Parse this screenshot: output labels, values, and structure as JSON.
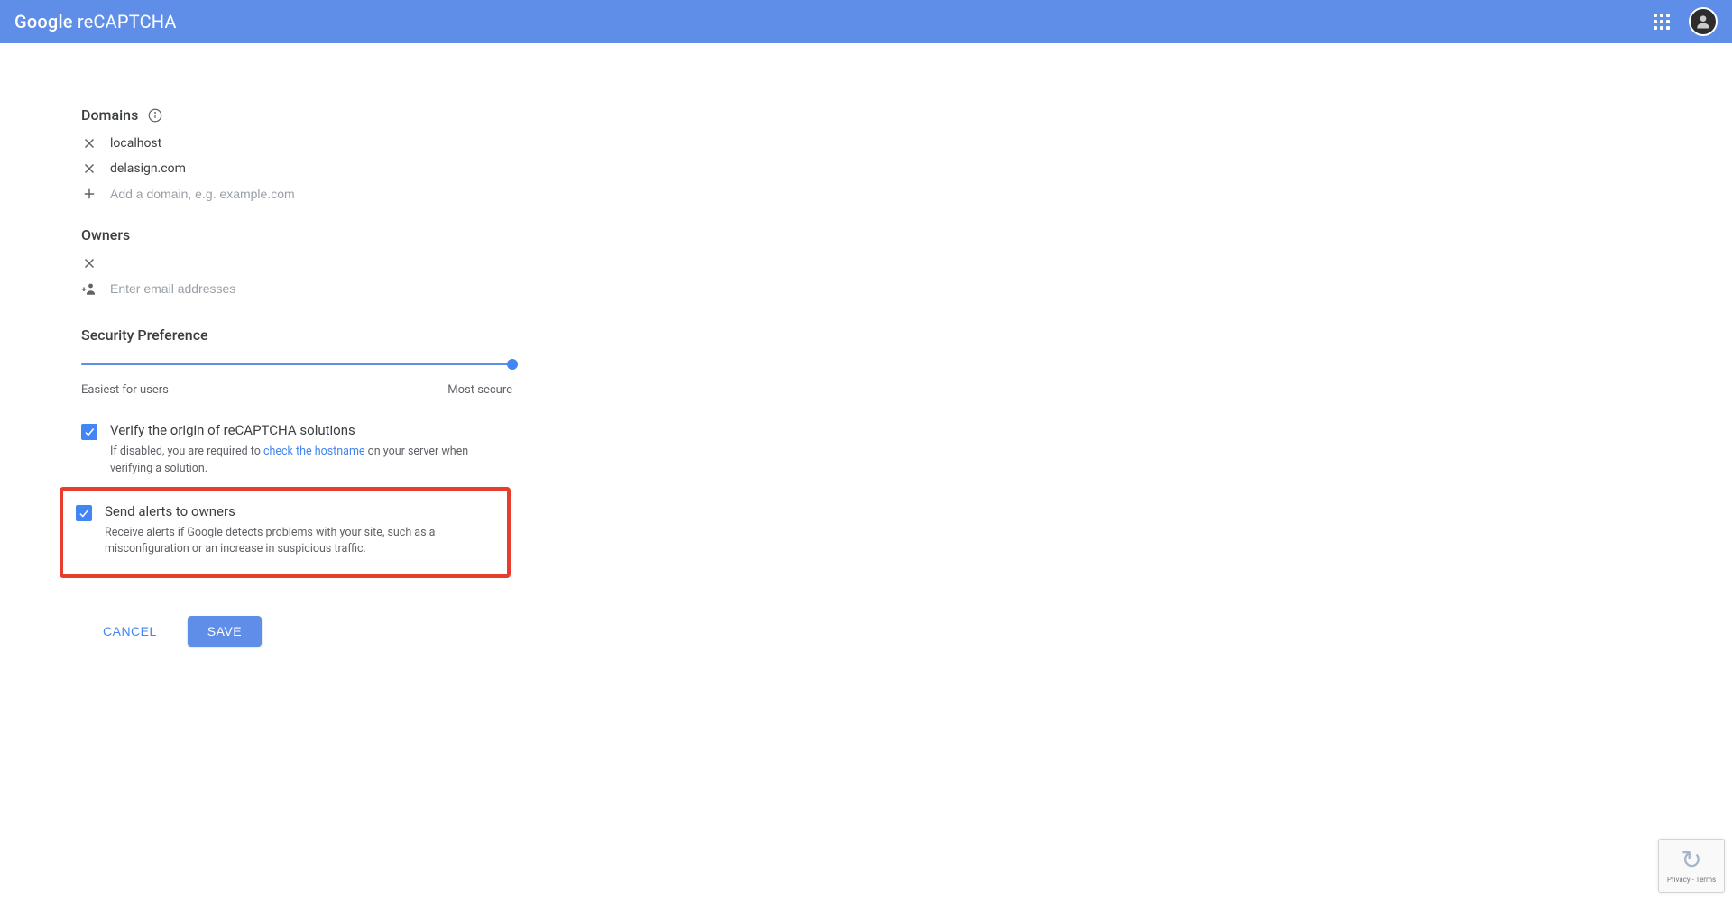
{
  "header": {
    "title_google": "Google",
    "title_rest": " reCAPTCHA"
  },
  "sections": {
    "domains_title": "Domains",
    "owners_title": "Owners",
    "security_title": "Security Preference"
  },
  "domains": {
    "items": [
      {
        "name": "localhost"
      },
      {
        "name": "delasign.com"
      }
    ],
    "add_placeholder": "Add a domain, e.g. example.com"
  },
  "owners": {
    "add_placeholder": "Enter email addresses"
  },
  "slider": {
    "left_label": "Easiest for users",
    "right_label": "Most secure"
  },
  "verify": {
    "label": "Verify the origin of reCAPTCHA solutions",
    "desc_prefix": "If disabled, you are required to ",
    "desc_link": "check the hostname",
    "desc_suffix": " on your server when verifying a solution."
  },
  "alerts": {
    "label": "Send alerts to owners",
    "desc": "Receive alerts if Google detects problems with your site, such as a misconfiguration or an increase in suspicious traffic."
  },
  "buttons": {
    "cancel": "CANCEL",
    "save": "SAVE"
  },
  "badge": {
    "terms": "Privacy - Terms"
  }
}
